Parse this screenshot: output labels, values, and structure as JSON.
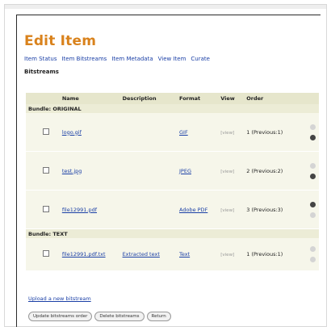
{
  "page": {
    "title": "Edit Item",
    "tabs": [
      "Item Status",
      "Item Bitstreams",
      "Item Metadata",
      "View Item",
      "Curate"
    ],
    "section_heading": "Bitstreams",
    "columns": [
      "Name",
      "Description",
      "Format",
      "View",
      "Order"
    ],
    "bundles": [
      {
        "label": "Bundle: ORIGINAL",
        "rows": [
          {
            "name": "logo.gif",
            "description": "",
            "format": "GIF",
            "view": "[view]",
            "order": "1 (Previous:1)",
            "up": "light",
            "down": "dark"
          },
          {
            "name": "test.jpg",
            "description": "",
            "format": "JPEG",
            "view": "[view]",
            "order": "2 (Previous:2)",
            "up": "light",
            "down": "dark"
          },
          {
            "name": "file12991.pdf",
            "description": "",
            "format": "Adobe PDF",
            "view": "[view]",
            "order": "3 (Previous:3)",
            "up": "dark",
            "down": "light"
          }
        ]
      },
      {
        "label": "Bundle: TEXT",
        "rows": [
          {
            "name": "file12991.pdf.txt",
            "description": "Extracted text",
            "format": "Text",
            "view": "[view]",
            "order": "1 (Previous:1)",
            "up": "light",
            "down": "light"
          }
        ]
      }
    ],
    "upload_link": "Upload a new bitstream",
    "buttons": [
      "Update bitstreams order",
      "Delete bitstreams",
      "Return"
    ]
  }
}
